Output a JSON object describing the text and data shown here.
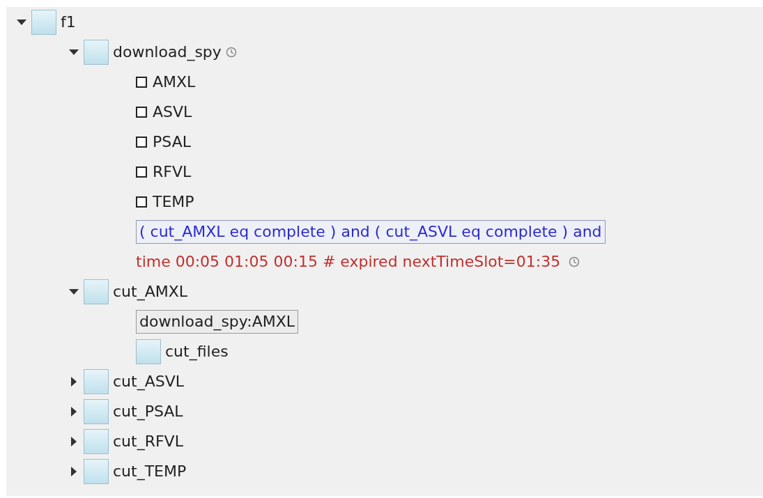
{
  "tree": [
    {
      "kind": "node",
      "name": "f1",
      "expanded": true,
      "children": [
        {
          "kind": "node",
          "name": "download_spy",
          "expanded": true,
          "timed": true,
          "children": [
            {
              "kind": "event",
              "name": "AMXL",
              "checked": false
            },
            {
              "kind": "event",
              "name": "ASVL",
              "checked": false
            },
            {
              "kind": "event",
              "name": "PSAL",
              "checked": false
            },
            {
              "kind": "event",
              "name": "RFVL",
              "checked": false
            },
            {
              "kind": "event",
              "name": "TEMP",
              "checked": false
            },
            {
              "kind": "trigger",
              "text": "( cut_AMXL eq complete ) and ( cut_ASVL eq complete ) and"
            },
            {
              "kind": "time",
              "text": "time 00:05 01:05 00:15 # expired nextTimeSlot=01:35"
            }
          ]
        },
        {
          "kind": "node",
          "name": "cut_AMXL",
          "expanded": true,
          "children": [
            {
              "kind": "event_trigger",
              "text": "download_spy:AMXL"
            },
            {
              "kind": "node",
              "name": "cut_files"
            }
          ]
        },
        {
          "kind": "node",
          "name": "cut_ASVL",
          "expanded": false
        },
        {
          "kind": "node",
          "name": "cut_PSAL",
          "expanded": false
        },
        {
          "kind": "node",
          "name": "cut_RFVL",
          "expanded": false
        },
        {
          "kind": "node",
          "name": "cut_TEMP",
          "expanded": false
        }
      ]
    }
  ]
}
